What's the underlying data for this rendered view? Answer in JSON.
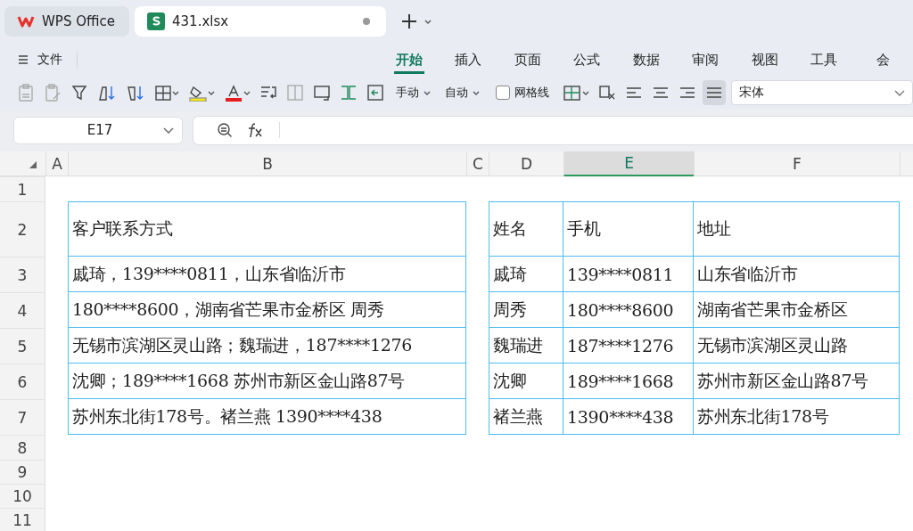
{
  "title_tabs": [
    {
      "label": "WPS Office",
      "kind": "home",
      "selected": false
    },
    {
      "label": "431.xlsx",
      "kind": "sheet",
      "selected": true
    }
  ],
  "menu": {
    "file_label": "文件",
    "tabs": [
      {
        "label": "开始",
        "selected": true
      },
      {
        "label": "插入",
        "selected": false
      },
      {
        "label": "页面",
        "selected": false
      },
      {
        "label": "公式",
        "selected": false
      },
      {
        "label": "数据",
        "selected": false
      },
      {
        "label": "审阅",
        "selected": false
      },
      {
        "label": "视图",
        "selected": false
      },
      {
        "label": "工具",
        "selected": false
      },
      {
        "label": "会",
        "selected": false
      }
    ]
  },
  "toolbar": {
    "row_height_label": "手动",
    "column_width_label": "自动",
    "gridlines": {
      "label": "网格线",
      "checked": false
    },
    "align_buttons": [
      {
        "selected": false
      },
      {
        "selected": false
      },
      {
        "selected": false
      },
      {
        "selected": true
      }
    ],
    "font": "宋体"
  },
  "formula_bar": {
    "name_box": "E17"
  },
  "sheet": {
    "columns": [
      {
        "label": "A",
        "selected": false
      },
      {
        "label": "B",
        "selected": false
      },
      {
        "label": "C",
        "selected": false
      },
      {
        "label": "D",
        "selected": false
      },
      {
        "label": "E",
        "selected": true
      },
      {
        "label": "F",
        "selected": false
      }
    ],
    "rows": [
      "1",
      "2",
      "3",
      "4",
      "5",
      "6",
      "7",
      "8",
      "9",
      "10",
      "11"
    ],
    "left_table": [
      [
        "客户联系方式"
      ],
      [
        "戚琦，139****0811，山东省临沂市"
      ],
      [
        "180****8600，湖南省芒果市金桥区 周秀"
      ],
      [
        "无锡市滨湖区灵山路；魏瑞进，187****1276"
      ],
      [
        "沈卿；189****1668 苏州市新区金山路87号"
      ],
      [
        "苏州东北街178号。褚兰燕 1390****438"
      ]
    ],
    "right_table": [
      [
        "姓名",
        "手机",
        "地址"
      ],
      [
        "戚琦",
        "139****0811",
        "山东省临沂市"
      ],
      [
        "周秀",
        "180****8600",
        "湖南省芒果市金桥区"
      ],
      [
        "魏瑞进",
        "187****1276",
        "无锡市滨湖区灵山路"
      ],
      [
        "沈卿",
        "189****1668",
        "苏州市新区金山路87号"
      ],
      [
        "褚兰燕",
        "1390****438",
        "苏州东北街178号"
      ]
    ]
  }
}
